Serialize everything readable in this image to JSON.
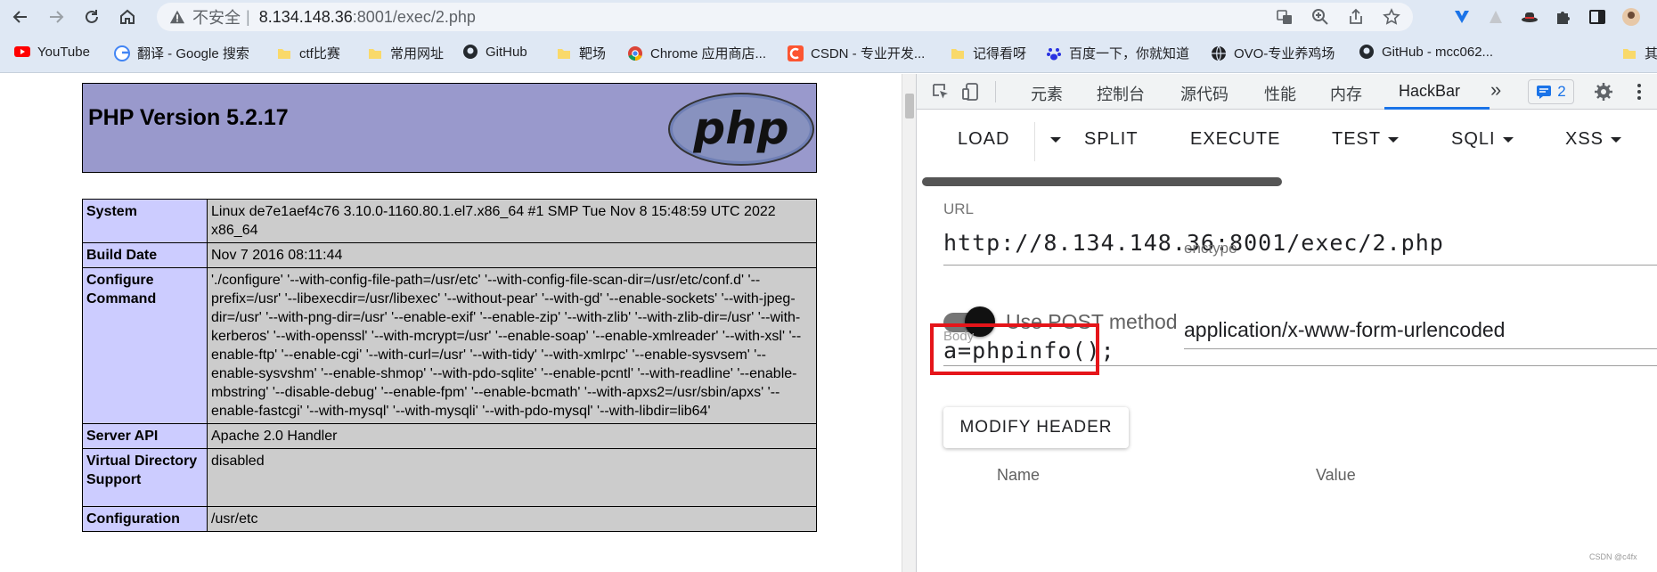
{
  "browser": {
    "url_warning": "不安全",
    "url_separator": "|",
    "url_host": "8.134.148.36",
    "url_path": ":8001/exec/2.php"
  },
  "bookmarks": [
    {
      "label": "YouTube",
      "icon": "youtube-icon"
    },
    {
      "label": "翻译 - Google 搜索",
      "icon": "google-icon"
    },
    {
      "label": "ctf比赛",
      "icon": "folder-icon"
    },
    {
      "label": "常用网址",
      "icon": "folder-icon"
    },
    {
      "label": "GitHub",
      "icon": "github-icon"
    },
    {
      "label": "靶场",
      "icon": "folder-icon"
    },
    {
      "label": "Chrome 应用商店...",
      "icon": "chrome-icon"
    },
    {
      "label": "CSDN - 专业开发...",
      "icon": "csdn-icon"
    },
    {
      "label": "记得看呀",
      "icon": "folder-icon"
    },
    {
      "label": "百度一下，你就知道",
      "icon": "baidu-icon"
    },
    {
      "label": "OVO-专业养鸡场",
      "icon": "globe-icon"
    },
    {
      "label": "GitHub - mcc062...",
      "icon": "github-icon"
    },
    {
      "label": "其",
      "icon": "folder-icon"
    }
  ],
  "phpinfo": {
    "title": "PHP Version 5.2.17",
    "logo_text": "php",
    "rows": [
      {
        "key": "System",
        "value": "Linux de7e1aef4c76 3.10.0-1160.80.1.el7.x86_64 #1 SMP Tue Nov 8 15:48:59 UTC 2022 x86_64"
      },
      {
        "key": "Build Date",
        "value": "Nov 7 2016 08:11:44"
      },
      {
        "key": "Configure Command",
        "value": "'./configure' '--with-config-file-path=/usr/etc' '--with-config-file-scan-dir=/usr/etc/conf.d' '--prefix=/usr' '--libexecdir=/usr/libexec' '--without-pear' '--with-gd' '--enable-sockets' '--with-jpeg-dir=/usr' '--with-png-dir=/usr' '--enable-exif' '--enable-zip' '--with-zlib' '--with-zlib-dir=/usr' '--with-kerberos' '--with-openssl' '--with-mcrypt=/usr' '--enable-soap' '--enable-xmlreader' '--with-xsl' '--enable-ftp' '--enable-cgi' '--with-curl=/usr' '--with-tidy' '--with-xmlrpc' '--enable-sysvsem' '--enable-sysvshm' '--enable-shmop' '--with-pdo-sqlite' '--enable-pcntl' '--with-readline' '--enable-mbstring' '--disable-debug' '--enable-fpm' '--enable-bcmath' '--with-apxs2=/usr/sbin/apxs' '--enable-fastcgi' '--with-mysql' '--with-mysqli' '--with-pdo-mysql' '--with-libdir=lib64'"
      },
      {
        "key": "Server API",
        "value": "Apache 2.0 Handler"
      },
      {
        "key": "Virtual Directory Support",
        "value": "disabled"
      },
      {
        "key": "Configuration",
        "value": "/usr/etc"
      }
    ]
  },
  "devtools": {
    "tabs": [
      "元素",
      "控制台",
      "源代码",
      "性能",
      "内存",
      "HackBar"
    ],
    "active_tab": "HackBar",
    "more_tabs": "»",
    "message_count": "2"
  },
  "hackbar": {
    "menu": [
      "LOAD",
      "SPLIT",
      "EXECUTE",
      "TEST",
      "SQLI",
      "XSS"
    ],
    "url_label": "URL",
    "url_value": "http://8.134.148.36:8001/exec/2.php",
    "post_label": "Use POST method",
    "post_enabled": true,
    "enctype_label": "enctype",
    "enctype_value": "application/x-www-form-urlencoded",
    "body_label": "Body",
    "body_value": "a=phpinfo();",
    "modify_header": "MODIFY HEADER",
    "header_cols": [
      "Name",
      "Value"
    ]
  },
  "watermark": "CSDN @c4fx",
  "colors": {
    "php_header": "#9999cc",
    "key_cell": "#ccccff",
    "value_cell": "#cccccc",
    "highlight": "#e5151a",
    "accent": "#1a73e8"
  }
}
